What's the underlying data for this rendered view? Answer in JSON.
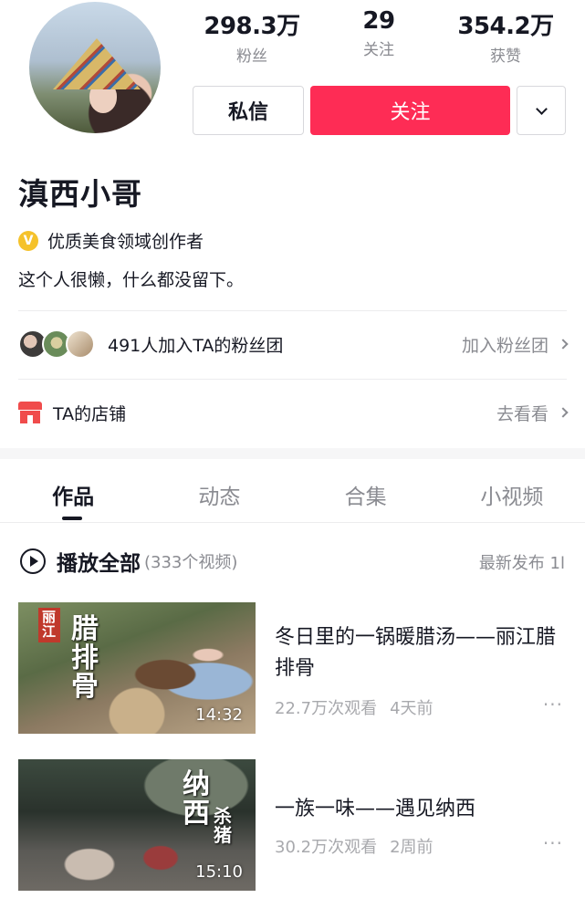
{
  "profile": {
    "stats": [
      {
        "value": "298.3万",
        "label": "粉丝"
      },
      {
        "value": "29",
        "label": "关注"
      },
      {
        "value": "354.2万",
        "label": "获赞"
      }
    ],
    "message_button": "私信",
    "follow_button": "关注",
    "name": "滇西小哥",
    "verify_badge": "V",
    "verified_label": "优质美食领域创作者",
    "bio": "这个人很懒，什么都没留下。"
  },
  "fan_club": {
    "text": "491人加入TA的粉丝团",
    "action": "加入粉丝团"
  },
  "shop": {
    "text": "TA的店铺",
    "action": "去看看"
  },
  "tabs": [
    {
      "label": "作品",
      "active": true
    },
    {
      "label": "动态",
      "active": false
    },
    {
      "label": "合集",
      "active": false
    },
    {
      "label": "小视频",
      "active": false
    }
  ],
  "playlist": {
    "play_all": "播放全部",
    "count": "(333个视频)",
    "sort": "最新发布 1l"
  },
  "videos": [
    {
      "title": "冬日里的一锅暖腊汤——丽江腊排骨",
      "views": "22.7万次观看",
      "age": "4天前",
      "duration": "14:32",
      "overlay_tag": "丽江",
      "overlay_title": "腊排骨",
      "more": "···"
    },
    {
      "title": "一族一味——遇见纳西",
      "views": "30.2万次观看",
      "age": "2周前",
      "duration": "15:10",
      "overlay_title": "纳西",
      "overlay_sub": "杀猪",
      "more": "···"
    }
  ]
}
